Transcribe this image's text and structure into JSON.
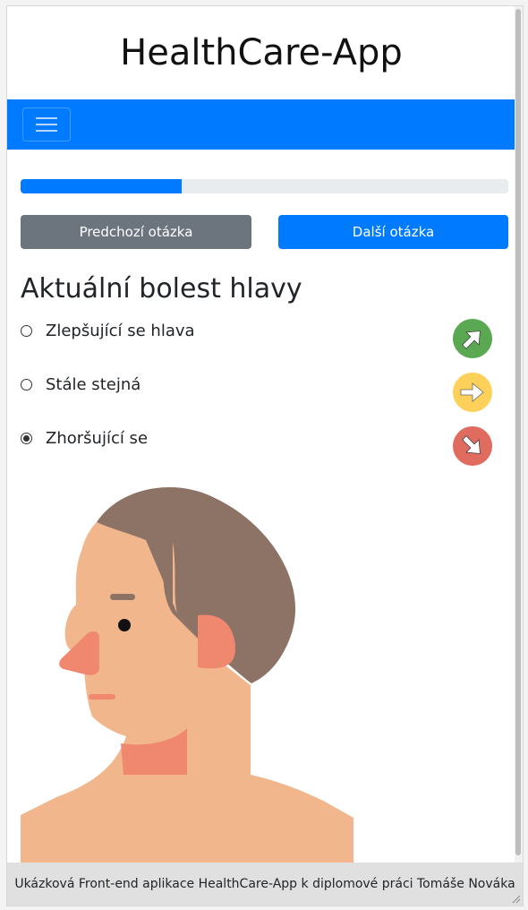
{
  "app": {
    "title": "HealthCare-App"
  },
  "navbar": {
    "toggler_icon": "hamburger-icon",
    "color": "#007bff"
  },
  "progress": {
    "value": 0.33
  },
  "buttons": {
    "prev_label": "Predchozí otázka",
    "next_label": "Další otázka"
  },
  "question": {
    "title": "Aktuální bolest hlavy",
    "options": [
      {
        "label": "Zlepšující se hlava",
        "checked": false,
        "icon": "arrow-up-right-icon",
        "icon_color": "#5ba852"
      },
      {
        "label": "Stále stejná",
        "checked": false,
        "icon": "arrow-right-icon",
        "icon_color": "#fdd05a"
      },
      {
        "label": "Zhoršující se",
        "checked": true,
        "icon": "arrow-down-right-icon",
        "icon_color": "#e06b5f"
      }
    ]
  },
  "footer": {
    "text": "Ukázková Front-end aplikace HealthCare-App k diplomové práci Tomáše Nováka"
  }
}
